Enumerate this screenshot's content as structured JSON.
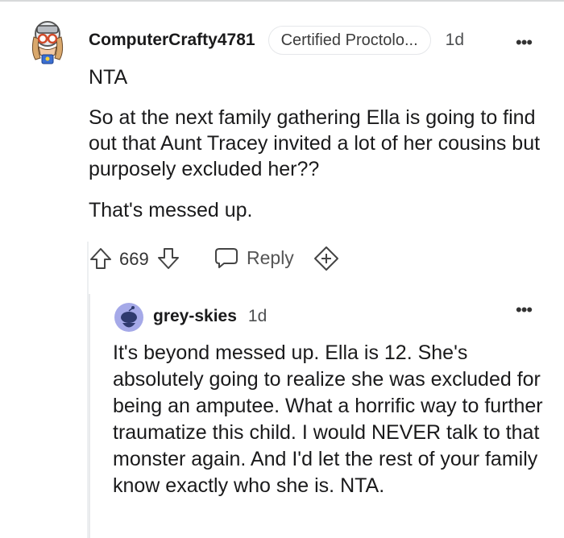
{
  "comment": {
    "username": "ComputerCrafty4781",
    "flair": "Certified Proctolo...",
    "age": "1d",
    "paragraphs": [
      "NTA",
      "So at the next family gathering Ella is going to find out that Aunt Tracey invited a lot of her cousins but purposely excluded her??",
      "That's messed up."
    ],
    "vote_count": "669",
    "reply_label": "Reply"
  },
  "reply": {
    "username": "grey-skies",
    "age": "1d",
    "text": "It's beyond messed up. Ella is 12. She's absolutely going to realize she was excluded for being an amputee. What a horrific way to further traumatize this child. I would NEVER talk to that monster again. And I'd let the rest of your family know exactly who she is. NTA."
  },
  "icons": {
    "upvote": "arrow-up-icon",
    "downvote": "arrow-down-icon",
    "reply": "speech-bubble-icon",
    "award": "add-award-icon",
    "more": "more-options-icon"
  },
  "colors": {
    "text": "#1a1a1b",
    "muted": "#4d4f51",
    "reply_avatar_bg": "#a5a9e8"
  }
}
